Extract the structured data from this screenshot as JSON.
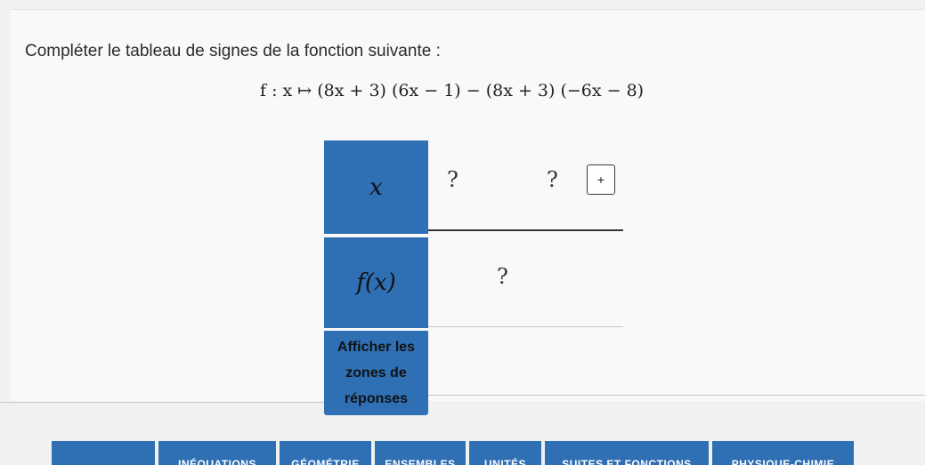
{
  "exercise": {
    "instruction": "Compléter le tableau de signes de la fonction suivante :",
    "formula": "f : x ↦ (8x + 3) (6x − 1) − (8x + 3) (−6x − 8)"
  },
  "sign_table": {
    "x_label": "x",
    "fx_label": "f(x)",
    "x_values": [
      "?",
      "?"
    ],
    "plus_infinity_button": "+",
    "fx_sign": "?",
    "reveal_button": {
      "line1": "Afficher les",
      "line2": "zones de",
      "line3": "réponses"
    },
    "accent_color": "#2f6fb3"
  },
  "bottom_nav": {
    "items": [
      "",
      "INÉQUATIONS",
      "GÉOMÉTRIE",
      "ENSEMBLES",
      "UNITÉS",
      "SUITES ET FONCTIONS",
      "PHYSIQUE-CHIMIE"
    ]
  }
}
